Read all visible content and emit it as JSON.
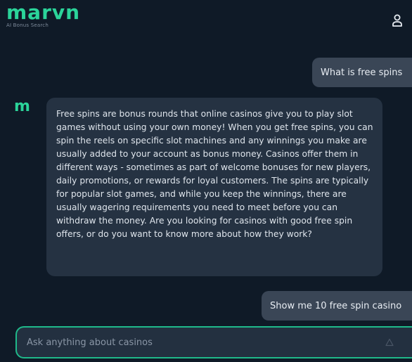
{
  "header": {
    "logo": "marvn",
    "tagline": "AI Bonus Search",
    "user_icon": "user-icon"
  },
  "messages": [
    {
      "role": "user",
      "text": "What is free spins"
    },
    {
      "role": "assistant",
      "avatar": "m",
      "text": "Free spins are bonus rounds that online casinos give you to play slot games without using your own money! When you get free spins, you can spin the reels on specific slot machines and any winnings you make are usually added to your account as bonus money. Casinos offer them in different ways - sometimes as part of welcome bonuses for new players, daily promotions, or rewards for loyal customers. The spins are typically for popular slot games, and while you keep the winnings, there are usually wagering requirements you need to meet before you can withdraw the money. Are you looking for casinos with good free spin offers, or do you want to know more about how they work?"
    },
    {
      "role": "user",
      "text": "Show me 10 free spin casino"
    }
  ],
  "composer": {
    "placeholder": "Ask anything about casinos",
    "value": "",
    "send_icon": "send-icon"
  },
  "colors": {
    "accent": "#2bd49a",
    "background": "#0f1a27",
    "user_bubble": "#3a4656",
    "bot_bubble": "#253242"
  }
}
